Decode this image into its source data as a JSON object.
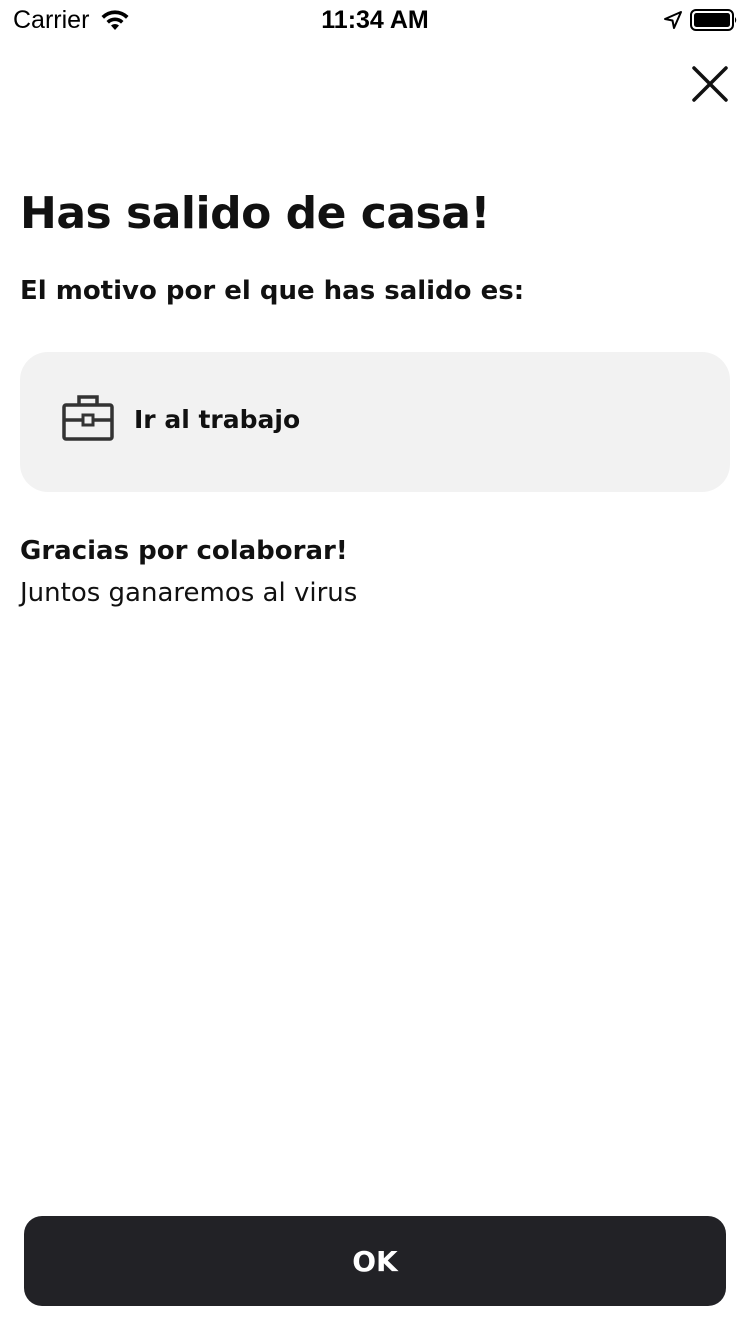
{
  "status_bar": {
    "carrier": "Carrier",
    "time": "11:34 AM",
    "icons": [
      "wifi-icon",
      "location-arrow-icon",
      "battery-icon"
    ]
  },
  "header": {
    "close_icon": "close-icon"
  },
  "main": {
    "title": "Has salido de casa!",
    "subtitle": "El motivo por el que has salido es:",
    "reason": {
      "icon": "briefcase-icon",
      "label": "Ir al trabajo"
    },
    "thanks": "Gracias por colaborar!",
    "together": "Juntos ganaremos al virus"
  },
  "footer": {
    "ok_label": "OK"
  },
  "colors": {
    "background": "#ffffff",
    "card_background": "#f2f2f2",
    "button_background": "#222226",
    "button_text": "#ffffff",
    "text": "#111111"
  }
}
